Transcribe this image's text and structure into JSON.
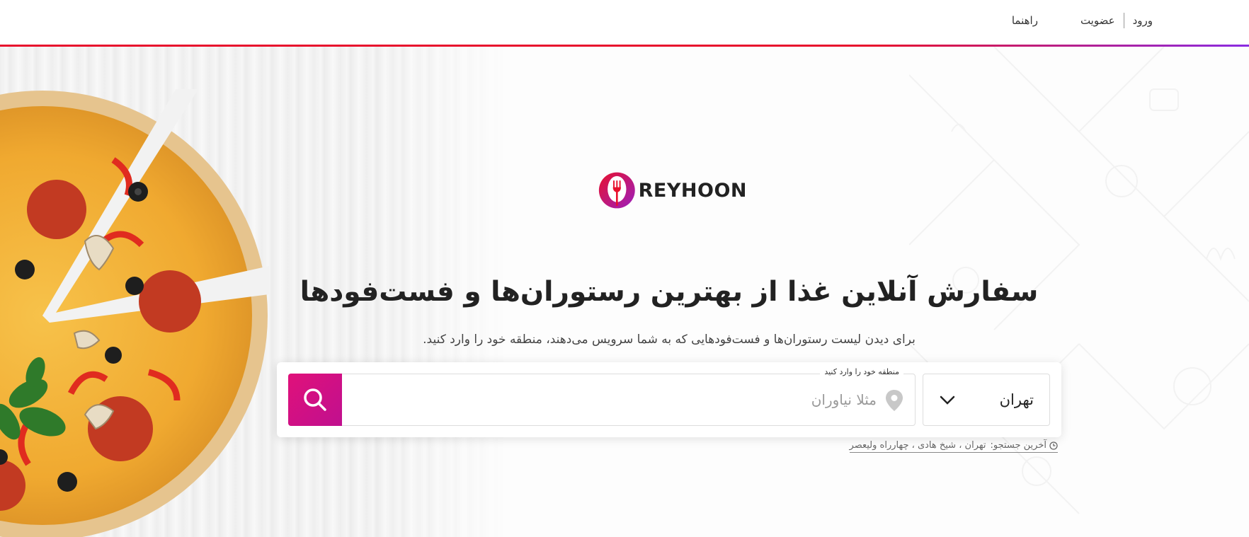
{
  "nav": {
    "login": "ورود",
    "signup": "عضویت",
    "help": "راهنما"
  },
  "brand": {
    "name": "REYHOON",
    "accent_red": "#e8112d",
    "accent_purple": "#8a2be2",
    "accent_magenta": "#e0117a"
  },
  "hero": {
    "headline": "سفارش آنلاین غذا از بهترین رستوران‌ها و فست‌فودها",
    "subhead": "برای دیدن لیست رستوران‌ها و فست‌فودهایی که به شما سرویس می‌دهند، منطقه خود را وارد کنید."
  },
  "search": {
    "city": "تهران",
    "field_label": "منطقه خود را وارد کنید",
    "placeholder": "مثلا نیاوران",
    "value": "",
    "recent_label": "آخرین جستجو:",
    "recent_value": "تهران ، شیخ هادی ، چهارراه ولیعصر"
  },
  "icons": {
    "chevron": "chevron-down-icon",
    "pin": "location-pin-icon",
    "search": "search-icon",
    "clock": "clock-icon"
  }
}
